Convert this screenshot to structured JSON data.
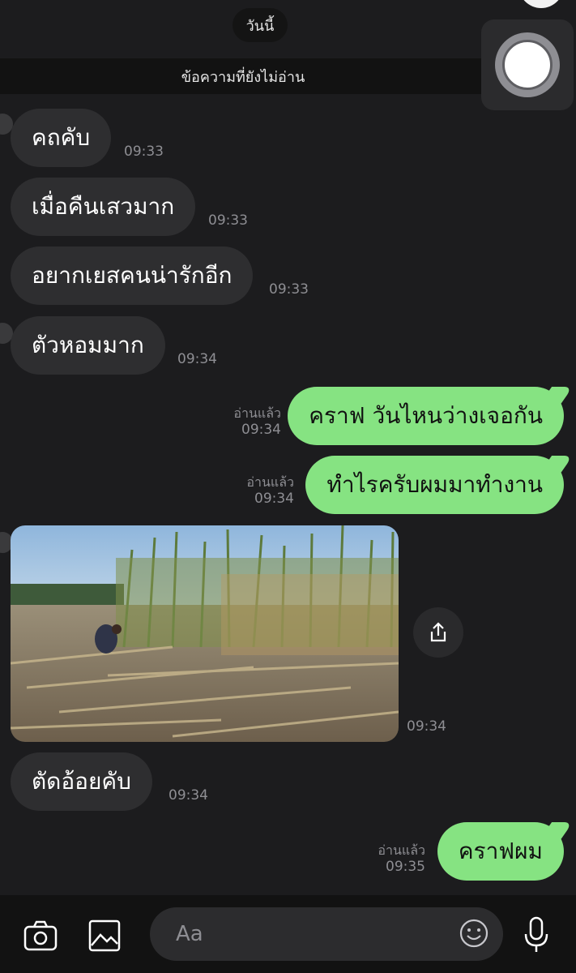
{
  "header": {
    "date_label": "วันนี้",
    "unread_label": "ข้อความที่ยังไม่อ่าน"
  },
  "messages": [
    {
      "dir": "in",
      "text": "คถคับ",
      "time": "09:33"
    },
    {
      "dir": "in",
      "text": "เมื่อคืนเสวมาก",
      "time": "09:33"
    },
    {
      "dir": "in",
      "text": "อยากเยสคนน่ารักอีก",
      "time": "09:33"
    },
    {
      "dir": "in",
      "text": "ตัวหอมมาก",
      "time": "09:34"
    },
    {
      "dir": "out",
      "text": "คราฟ วันไหนว่างเจอกัน",
      "read": "อ่านแล้ว",
      "time": "09:34"
    },
    {
      "dir": "out",
      "text": "ทำไรครับผมมาทำงาน",
      "read": "อ่านแล้ว",
      "time": "09:34"
    },
    {
      "dir": "in",
      "type": "image",
      "time": "09:34"
    },
    {
      "dir": "in",
      "text": "ตัดอ้อยคับ",
      "time": "09:34"
    },
    {
      "dir": "out",
      "text": "คราฟผม",
      "read": "อ่านแล้ว",
      "time": "09:35"
    }
  ],
  "input": {
    "placeholder": "Aa"
  },
  "icons": [
    "camera-icon",
    "image-icon",
    "emoji-icon",
    "microphone-icon",
    "share-icon"
  ],
  "colors": {
    "background": "#1c1c1e",
    "incoming_bubble": "#2e2e30",
    "outgoing_bubble": "#86e382"
  }
}
